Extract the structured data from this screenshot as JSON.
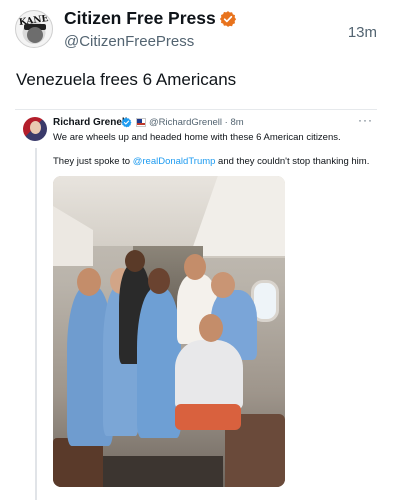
{
  "post": {
    "display_name": "Citizen Free Press",
    "handle": "@CitizenFreePress",
    "timestamp": "13m",
    "text": "Venezuela frees 6 Americans",
    "avatar_text": "KANE"
  },
  "quote": {
    "name": "Richard Grenell",
    "handle_time": "@RichardGrenell · 8m",
    "more": "···",
    "text_line1": "We are wheels up and headed home with these 6 American citizens.",
    "text_line2_before": "They just spoke to ",
    "text_line2_mention": "@realDonaldTrump",
    "text_line2_after": " and they couldn't stop thanking him."
  },
  "colors": {
    "verified_orange": "#e8731d",
    "verified_blue": "#1d9bf0",
    "mention": "#1d9bf0",
    "secondary_text": "#536471"
  },
  "icons": {
    "verified_main": "verified-badge-icon",
    "verified_quote": "verified-badge-icon",
    "flag": "us-flag-icon",
    "more": "more-options-icon"
  }
}
